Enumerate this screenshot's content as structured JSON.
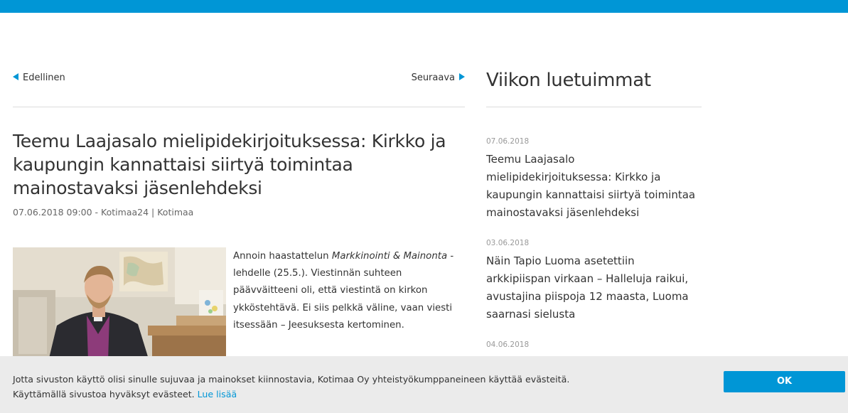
{
  "navigation": {
    "prev_label": "Edellinen",
    "next_label": "Seuraava"
  },
  "article": {
    "title": "Teemu Laajasalo mielipidekirjoituksessa: Kirkko ja kaupungin kannattaisi siirtyä toimintaa mainostavaksi jäsenlehdeksi",
    "date": "07.06.2018 09:00",
    "meta_sep1": " - ",
    "source": "Kotimaa24",
    "meta_sep2": " | ",
    "category": "Kotimaa",
    "lead_part1": "Annoin haastattelun ",
    "lead_italic": "Markkinointi & Mainonta",
    "lead_part2": " -lehdelle (25.5.). Viestinnän suhteen päävväitteeni oli, että viestintä on kirkon ykköstehtävä. Ei siis pelkkä väline, vaan viesti itsessään – Jeesuksesta kertominen."
  },
  "sidebar": {
    "title": "Viikon luetuimmat",
    "items": [
      {
        "date": "07.06.2018",
        "title": "Teemu Laajasalo mielipidekirjoituksessa: Kirkko ja kaupungin kannattaisi siirtyä toimintaa mainostavaksi jäsenlehdeksi"
      },
      {
        "date": "03.06.2018",
        "title": "Näin Tapio Luoma asetettiin arkkipiispan virkaan – Halleluja raikui, avustajina piispoja 12 maasta, Luoma saarnasi sielusta"
      },
      {
        "date": "04.06.2018",
        "title": ""
      }
    ]
  },
  "cookie_banner": {
    "line1": "Jotta sivuston käyttö olisi sinulle sujuvaa ja mainokset kiinnostavia, Kotimaa Oy yhteistyökumppaneineen käyttää evästeitä.",
    "line2": "Käyttämällä sivustoa hyväksyt evästeet. ",
    "link_label": "Lue lisää",
    "ok_label": "OK"
  },
  "colors": {
    "accent": "#0096d6",
    "banner_bg": "#ebebeb"
  }
}
